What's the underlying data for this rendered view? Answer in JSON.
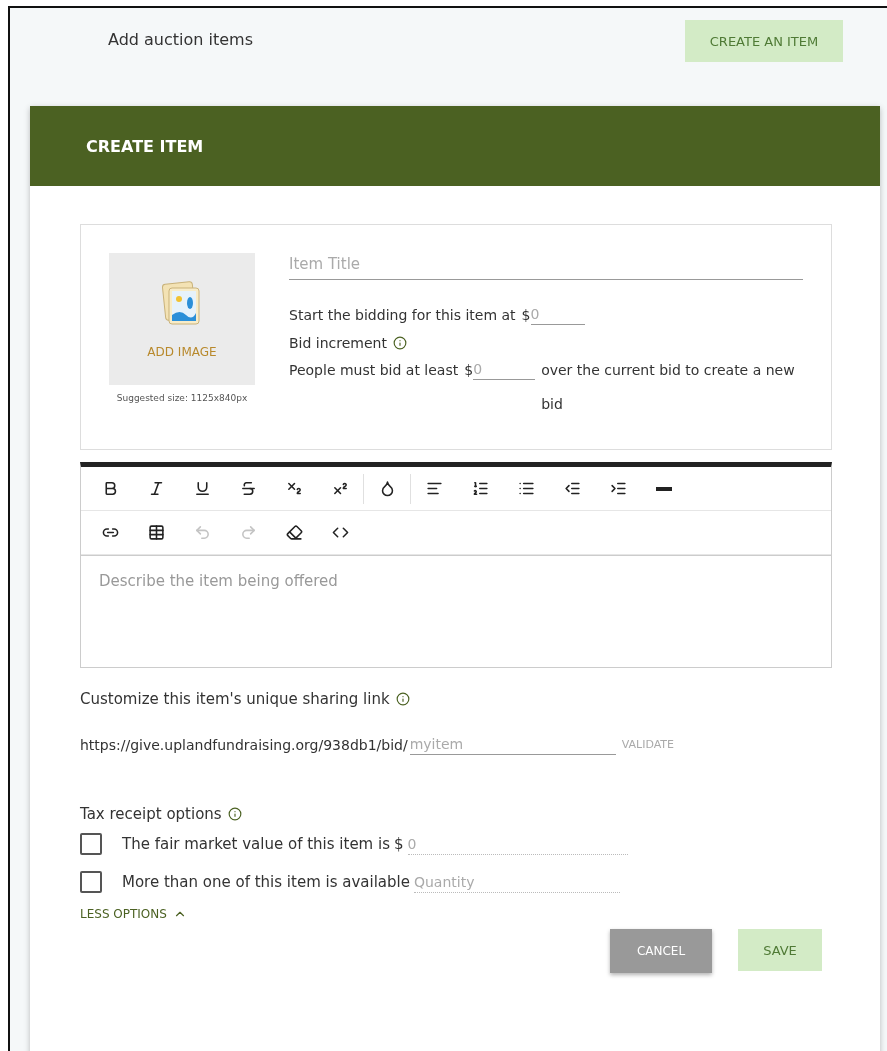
{
  "page": {
    "title": "Add auction items",
    "create_button": "CREATE AN ITEM"
  },
  "dialog": {
    "title": "CREATE ITEM",
    "image": {
      "label": "ADD IMAGE",
      "hint": "Suggested size: 1125x840px"
    },
    "item_title": {
      "placeholder": "Item Title"
    },
    "start_bid": {
      "label": "Start the bidding for this item at",
      "prefix": "$",
      "placeholder": "0"
    },
    "bid_increment": {
      "label": "Bid increment",
      "before": "People must bid at least",
      "prefix": "$",
      "placeholder": "0",
      "after": "over the current bid to create a new bid"
    },
    "toolbar": [
      [
        {
          "kind": "bold",
          "disabled": false
        },
        {
          "kind": "italic",
          "disabled": false
        },
        {
          "kind": "underline",
          "disabled": false
        },
        {
          "kind": "strike",
          "disabled": false
        },
        {
          "kind": "subscript",
          "disabled": false
        },
        {
          "kind": "superscript",
          "disabled": false
        },
        {
          "kind": "sep",
          "disabled": false
        },
        {
          "kind": "color",
          "disabled": false
        },
        {
          "kind": "sep",
          "disabled": false
        },
        {
          "kind": "align",
          "disabled": false
        },
        {
          "kind": "ordered",
          "disabled": false
        },
        {
          "kind": "bullets",
          "disabled": false
        },
        {
          "kind": "outdent",
          "disabled": false
        },
        {
          "kind": "indent",
          "disabled": false
        },
        {
          "kind": "rule",
          "disabled": false
        }
      ],
      [
        {
          "kind": "link",
          "disabled": false
        },
        {
          "kind": "table",
          "disabled": false
        },
        {
          "kind": "undo",
          "disabled": true
        },
        {
          "kind": "redo",
          "disabled": true
        },
        {
          "kind": "eraser",
          "disabled": false
        },
        {
          "kind": "code",
          "disabled": false
        }
      ]
    ],
    "description": {
      "placeholder": "Describe the item being offered"
    },
    "sharing": {
      "label": "Customize this item's unique sharing link",
      "url": "https://give.uplandfundraising.org/938db1/bid/",
      "placeholder": "myitem",
      "validate": "VALIDATE"
    },
    "tax": {
      "label": "Tax receipt options",
      "options": [
        {
          "label": "The fair market value of this item is",
          "prefix": "$",
          "placeholder": "0",
          "checked": false
        },
        {
          "label": "More than one of this item is available",
          "placeholder": "Quantity",
          "checked": false
        }
      ],
      "toggle": "LESS OPTIONS"
    },
    "buttons": {
      "cancel": "CANCEL",
      "save": "SAVE"
    }
  }
}
